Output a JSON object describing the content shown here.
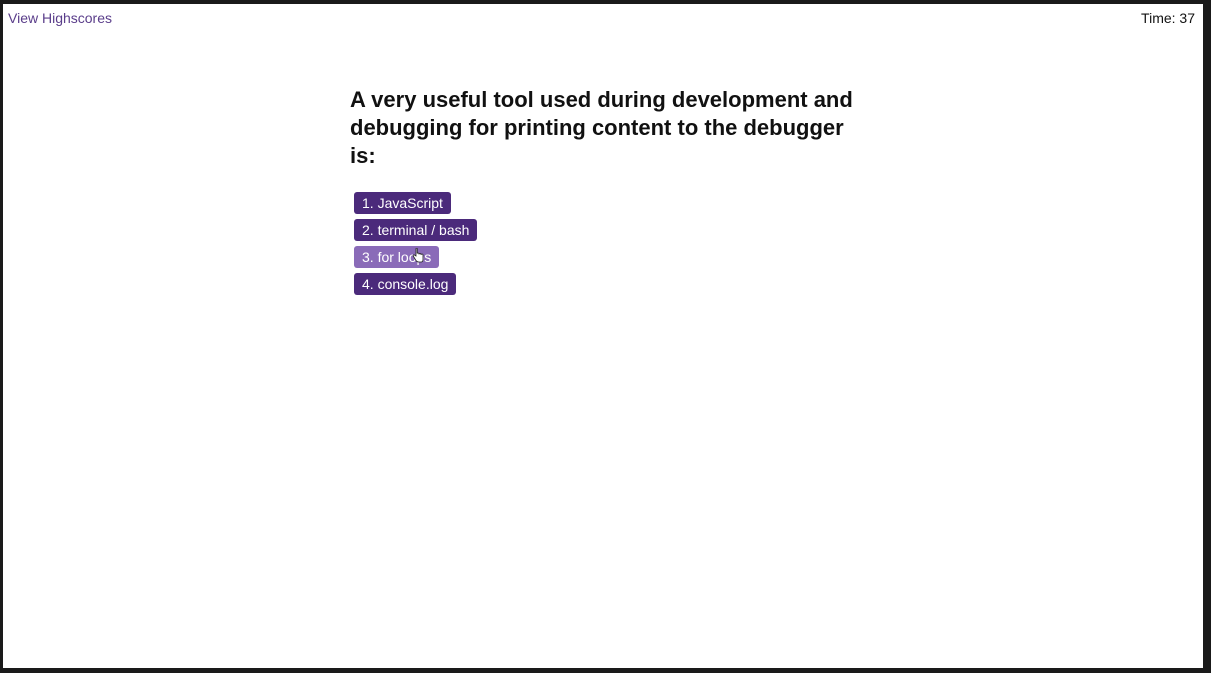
{
  "header": {
    "highscores_link": "View Highscores",
    "timer": "Time: 37"
  },
  "quiz": {
    "question": "A very useful tool used during development and debugging for printing content to the debugger is:",
    "choices": [
      {
        "label": "1. JavaScript",
        "state": "default"
      },
      {
        "label": "2. terminal / bash",
        "state": "default"
      },
      {
        "label": "3. for loops",
        "state": "hover"
      },
      {
        "label": "4. console.log",
        "state": "default"
      }
    ]
  },
  "colors": {
    "accent": "#4b2a7b",
    "accent_hover": "#8a6bb8",
    "link": "#5a3d8a",
    "background": "#ffffff"
  },
  "icons": {
    "cursor": "hand-pointer-icon"
  }
}
